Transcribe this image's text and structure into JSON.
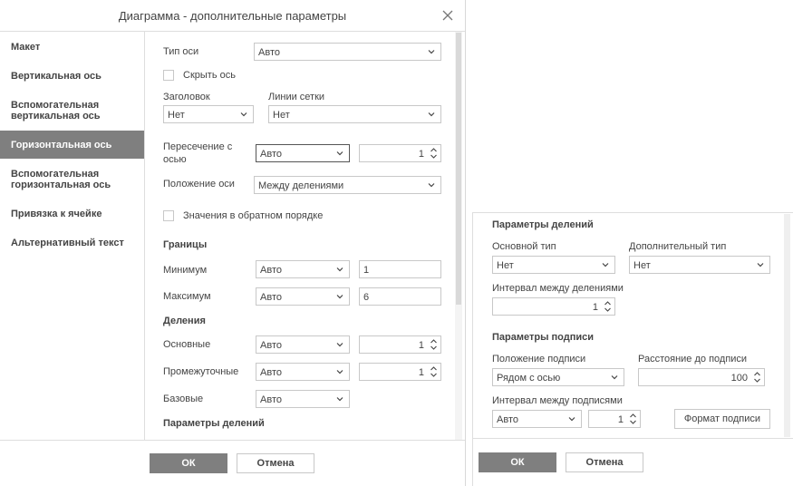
{
  "dialog": {
    "title": "Диаграмма - дополнительные параметры",
    "close_icon": "close-icon"
  },
  "sidebar": {
    "items": [
      {
        "label": "Макет",
        "active": false
      },
      {
        "label": "Вертикальная ось",
        "active": false
      },
      {
        "label": "Вспомогательная вертикальная ось",
        "active": false
      },
      {
        "label": "Горизонтальная ось",
        "active": true
      },
      {
        "label": "Вспомогательная горизонтальная ось",
        "active": false
      },
      {
        "label": "Привязка к ячейке",
        "active": false
      },
      {
        "label": "Альтернативный текст",
        "active": false
      }
    ]
  },
  "axis": {
    "type_label": "Тип оси",
    "type_value": "Авто",
    "hide_label": "Скрыть ось",
    "title_label": "Заголовок",
    "title_value": "Нет",
    "grid_label": "Линии сетки",
    "grid_value": "Нет",
    "cross_label": "Пересечение с осью",
    "cross_value": "Авто",
    "cross_number": "1",
    "position_label": "Положение оси",
    "position_value": "Между делениями",
    "reverse_label": "Значения в обратном порядке"
  },
  "bounds": {
    "header": "Границы",
    "min_label": "Минимум",
    "min_select": "Авто",
    "min_value": "1",
    "max_label": "Максимум",
    "max_select": "Авто",
    "max_value": "6"
  },
  "divisions": {
    "header": "Деления",
    "major_label": "Основные",
    "major_select": "Авто",
    "major_value": "1",
    "minor_label": "Промежуточные",
    "minor_select": "Авто",
    "minor_value": "1",
    "base_label": "Базовые",
    "base_select": "Авто",
    "tick_params_header": "Параметры делений"
  },
  "footer": {
    "ok_label": "ОК",
    "cancel_label": "Отмена"
  },
  "panel2": {
    "tick_params_header": "Параметры делений",
    "major_type_label": "Основной тип",
    "major_type_value": "Нет",
    "minor_type_label": "Дополнительный тип",
    "minor_type_value": "Нет",
    "tick_interval_label": "Интервал между делениями",
    "tick_interval_value": "1",
    "label_params_header": "Параметры подписи",
    "label_position_label": "Положение подписи",
    "label_position_value": "Рядом с осью",
    "label_distance_label": "Расстояние до подписи",
    "label_distance_value": "100",
    "label_interval_label": "Интервал между подписями",
    "label_interval_select": "Авто",
    "label_interval_value": "1",
    "label_format_button": "Формат подписи",
    "ok_label": "ОК",
    "cancel_label": "Отмена"
  }
}
